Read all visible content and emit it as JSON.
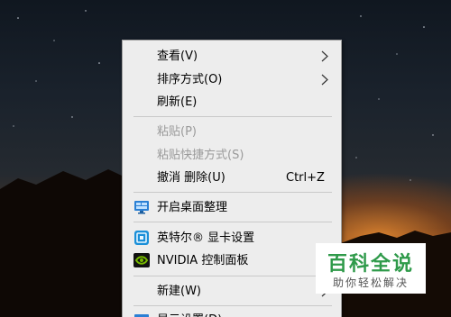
{
  "context_menu": {
    "items": [
      {
        "label": "查看(V)",
        "has_submenu": true
      },
      {
        "label": "排序方式(O)",
        "has_submenu": true
      },
      {
        "label": "刷新(E)"
      },
      {
        "label": "粘贴(P)",
        "disabled": true
      },
      {
        "label": "粘贴快捷方式(S)",
        "disabled": true
      },
      {
        "label": "撤消 删除(U)",
        "shortcut": "Ctrl+Z"
      },
      {
        "label": "开启桌面整理",
        "icon": "desktop-organize-icon"
      },
      {
        "label": "英特尔® 显卡设置",
        "icon": "intel-graphics-icon"
      },
      {
        "label": "NVIDIA 控制面板",
        "icon": "nvidia-icon"
      },
      {
        "label": "新建(W)",
        "has_submenu": true
      },
      {
        "label": "显示设置(D)",
        "icon": "display-settings-icon"
      }
    ]
  },
  "watermark": {
    "title": "百科全说",
    "subtitle": "助你轻松解决"
  },
  "colors": {
    "menu_bg": "#ededed",
    "disabled_text": "#9a9a9a",
    "watermark_green": "#2f9a4a"
  }
}
